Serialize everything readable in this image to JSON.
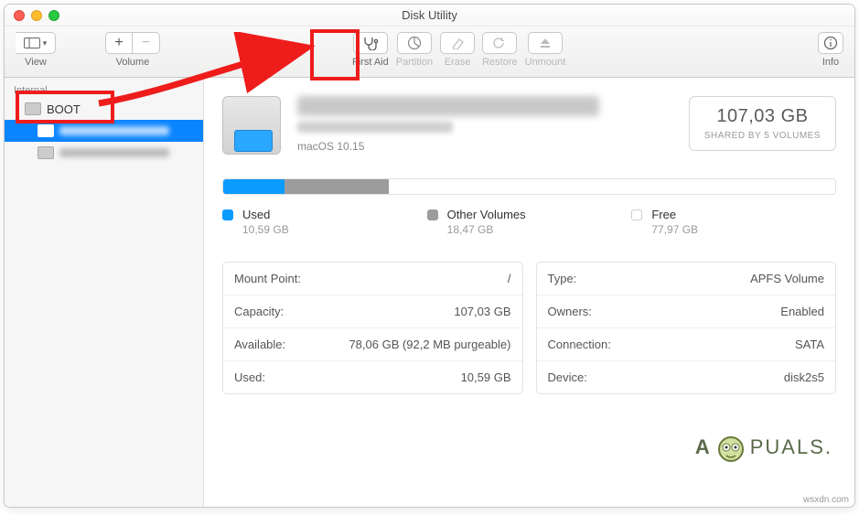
{
  "window": {
    "title": "Disk Utility"
  },
  "toolbar": {
    "view": "View",
    "volume": "Volume",
    "first_aid": "First Aid",
    "partition": "Partition",
    "erase": "Erase",
    "restore": "Restore",
    "unmount": "Unmount",
    "info": "Info"
  },
  "sidebar": {
    "section": "Internal",
    "items": [
      {
        "label": "BOOT",
        "selected": false,
        "child": false
      },
      {
        "label": "(blurred volume)",
        "selected": true,
        "child": true
      },
      {
        "label": "(blurred volume)",
        "selected": false,
        "child": true
      }
    ]
  },
  "volume": {
    "title_obscured": "macOS Catalina by Geekrar",
    "subtitle_obscured": "APFS Volume • APFS",
    "os_line": "macOS 10.15",
    "total_size": "107,03 GB",
    "total_caption": "SHARED BY 5 VOLUMES",
    "usage": {
      "used": {
        "label": "Used",
        "value": "10,59 GB",
        "percent": 10
      },
      "other": {
        "label": "Other Volumes",
        "value": "18,47 GB",
        "percent": 17
      },
      "free": {
        "label": "Free",
        "value": "77,97 GB",
        "percent": 73
      }
    },
    "details_left": [
      {
        "k": "Mount Point:",
        "v": "/"
      },
      {
        "k": "Capacity:",
        "v": "107,03 GB"
      },
      {
        "k": "Available:",
        "v": "78,06 GB (92,2 MB purgeable)"
      },
      {
        "k": "Used:",
        "v": "10,59 GB"
      }
    ],
    "details_right": [
      {
        "k": "Type:",
        "v": "APFS Volume"
      },
      {
        "k": "Owners:",
        "v": "Enabled"
      },
      {
        "k": "Connection:",
        "v": "SATA"
      },
      {
        "k": "Device:",
        "v": "disk2s5"
      }
    ]
  },
  "watermark": {
    "brand_left": "A",
    "brand_right": "PUALS."
  },
  "source_note": "wsxdn.com"
}
